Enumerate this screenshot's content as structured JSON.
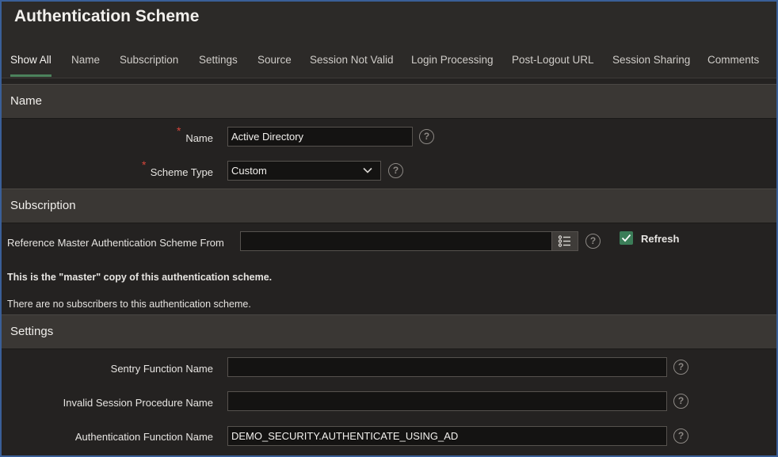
{
  "page": {
    "title": "Authentication Scheme"
  },
  "tabs": [
    {
      "label": "Show All"
    },
    {
      "label": "Name"
    },
    {
      "label": "Subscription"
    },
    {
      "label": "Settings"
    },
    {
      "label": "Source"
    },
    {
      "label": "Session Not Valid"
    },
    {
      "label": "Login Processing"
    },
    {
      "label": "Post-Logout URL"
    },
    {
      "label": "Session Sharing"
    },
    {
      "label": "Comments"
    }
  ],
  "active_tab": "Show All",
  "sections": {
    "name": {
      "title": "Name",
      "name_label": "Name",
      "name_value": "Active Directory",
      "scheme_type_label": "Scheme Type",
      "scheme_type_value": "Custom",
      "required_marker": "*"
    },
    "subscription": {
      "title": "Subscription",
      "reference_label": "Reference Master Authentication Scheme From",
      "reference_value": "",
      "refresh_label": "Refresh",
      "refresh_checked": true,
      "master_note": "This is the \"master\" copy of this authentication scheme.",
      "subscribers_note": "There are no subscribers to this authentication scheme."
    },
    "settings": {
      "title": "Settings",
      "sentry_label": "Sentry Function Name",
      "sentry_value": "",
      "invalid_session_label": "Invalid Session Procedure Name",
      "invalid_session_value": "",
      "auth_function_label": "Authentication Function Name",
      "auth_function_value": "DEMO_SECURITY.AUTHENTICATE_USING_AD"
    }
  },
  "help_glyph": "?",
  "icons": {
    "help": "question-circle-icon",
    "dropdown": "chevron-down-icon",
    "lov": "list-icon",
    "check": "checkmark-icon"
  },
  "colors": {
    "accent_tab": "#4c825c",
    "required": "#d6453a",
    "checkbox": "#3b7d58",
    "frame_border": "#3a5f98"
  }
}
